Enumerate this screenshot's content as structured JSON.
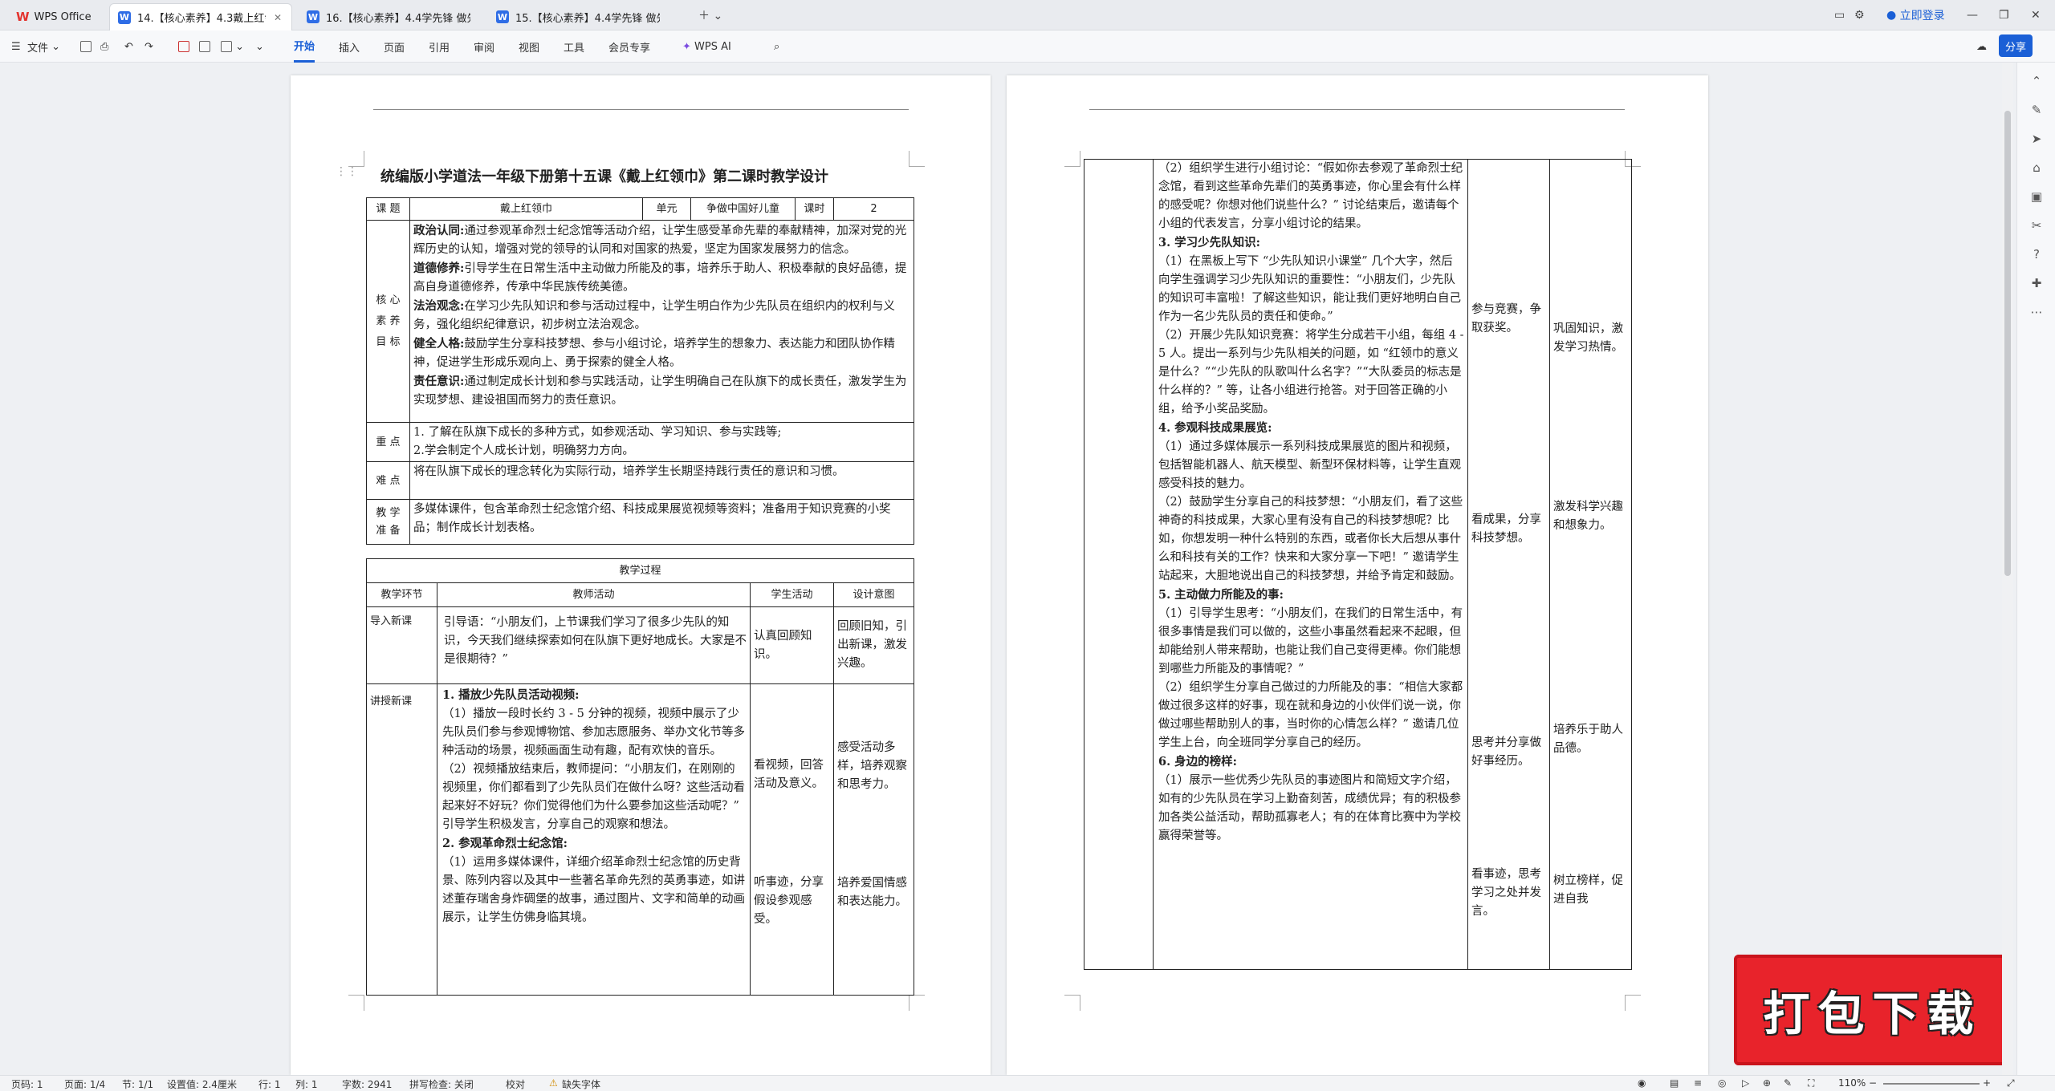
{
  "tabs": [
    {
      "label": "WPS Office"
    },
    {
      "label": "14.【核心素养】4.3戴上红领巾"
    },
    {
      "label": "16.【核心素养】4.4学先锋 做先锋 第"
    },
    {
      "label": "15.【核心素养】4.4学先锋 做先锋 第"
    }
  ],
  "window": {
    "login_label": "立即登录",
    "share_label": "分享"
  },
  "toolbar": {
    "file_label": "文件",
    "menus": [
      "开始",
      "插入",
      "页面",
      "引用",
      "审阅",
      "视图",
      "工具",
      "会员专享"
    ],
    "ai_label": "WPS AI"
  },
  "doc": {
    "title": "统编版小学道法一年级下册第十五课《戴上红领巾》第二课时教学设计",
    "info": {
      "course_label": "课 题",
      "course": "戴上红领巾",
      "unit_label": "单元",
      "unit": "争做中国好儿童",
      "period_label": "课时",
      "period": "2"
    },
    "goals_label": "核 心 素 养 目 标",
    "goals": [
      {
        "h": "政治认同:",
        "t": "通过参观革命烈士纪念馆等活动介绍，让学生感受革命先辈的奉献精神，加深对党的光辉历史的认知，增强对党的领导的认同和对国家的热爱，坚定为国家发展努力的信念。"
      },
      {
        "h": "道德修养:",
        "t": "引导学生在日常生活中主动做力所能及的事，培养乐于助人、积极奉献的良好品德，提高自身道德修养，传承中华民族传统美德。"
      },
      {
        "h": "法治观念:",
        "t": "在学习少先队知识和参与活动过程中，让学生明白作为少先队员在组织内的权利与义务，强化组织纪律意识，初步树立法治观念。"
      },
      {
        "h": "健全人格:",
        "t": "鼓励学生分享科技梦想、参与小组讨论，培养学生的想象力、表达能力和团队协作精神，促进学生形成乐观向上、勇于探索的健全人格。"
      },
      {
        "h": "责任意识:",
        "t": "通过制定成长计划和参与实践活动，让学生明确自己在队旗下的成长责任，激发学生为实现梦想、建设祖国而努力的责任意识。"
      }
    ],
    "key_label": "重 点",
    "key": [
      "1. 了解在队旗下成长的多种方式，如参观活动、学习知识、参与实践等;",
      "2.学会制定个人成长计划，明确努力方向。"
    ],
    "diff_label": "难 点",
    "diff": "将在队旗下成长的理念转化为实际行动，培养学生长期坚持践行责任的意识和习惯。",
    "prep_label": "教 学 准 备",
    "prep": "多媒体课件，包含革命烈士纪念馆介绍、科技成果展览视频等资料；准备用于知识竞赛的小奖品；制作成长计划表格。",
    "process_label": "教学过程",
    "headers": [
      "教学环节",
      "教师活动",
      "学生活动",
      "设计意图"
    ],
    "intro": {
      "stage": "导入新课",
      "teacher": "引导语：“小朋友们，上节课我们学习了很多少先队的知识，今天我们继续探索如何在队旗下更好地成长。大家是不是很期待？”",
      "student": "认真回顾知识。",
      "intent": "回顾旧知，引出新课，激发兴趣。"
    },
    "lesson": {
      "stage": "讲授新课",
      "t1h": "1.  播放少先队员活动视频:",
      "t1a": "（1）播放一段时长约 3 - 5 分钟的视频，视频中展示了少先队员们参与参观博物馆、参加志愿服务、举办文化节等多种活动的场景，视频画面生动有趣，配有欢快的音乐。",
      "t1b": "（2）视频播放结束后，教师提问：“小朋友们，在刚刚的视频里，你们都看到了少先队员们在做什么呀？这些活动看起来好不好玩？你们觉得他们为什么要参加这些活动呢？”  引导学生积极发言，分享自己的观察和想法。",
      "t2h": "2.  参观革命烈士纪念馆:",
      "t2a": "（1）运用多媒体课件，详细介绍革命烈士纪念馆的历史背景、陈列内容以及其中一些著名革命先烈的英勇事迹，如讲述董存瑞舍身炸碉堡的故事，通过图片、文字和简单的动画展示，让学生仿佛身临其境。",
      "s1": "看视频，回答活动及意义。",
      "i1": "感受活动多样，培养观察和思考力。",
      "s2": "听事迹，分享假设参观感受。",
      "i2": "培养爱国情感和表达能力。"
    },
    "p2": {
      "a": "（2）组织学生进行小组讨论：“假如你去参观了革命烈士纪念馆，看到这些革命先辈们的英勇事迹，你心里会有什么样的感受呢？你想对他们说些什么？”  讨论结束后，邀请每个小组的代表发言，分享小组讨论的结果。",
      "h3": "3.  学习少先队知识:",
      "b": "（1）在黑板上写下 “少先队知识小课堂” 几个大字，然后向学生强调学习少先队知识的重要性：“小朋友们，少先队的知识可丰富啦！了解这些知识，能让我们更好地明白自己作为一名少先队员的责任和使命。”",
      "c": "（2）开展少先队知识竞赛：将学生分成若干小组，每组 4 - 5 人。提出一系列与少先队相关的问题，如 “红领巾的意义是什么？”“少先队的队歌叫什么名字？”“大队委员的标志是什么样的？” 等，让各小组进行抢答。对于回答正确的小组，给予小奖品奖励。",
      "h4": "4.  参观科技成果展览:",
      "d": "（1）通过多媒体展示一系列科技成果展览的图片和视频，包括智能机器人、航天模型、新型环保材料等，让学生直观感受科技的魅力。",
      "e": "（2）鼓励学生分享自己的科技梦想：“小朋友们，看了这些神奇的科技成果，大家心里有没有自己的科技梦想呢？比如，你想发明一种什么特别的东西，或者你长大后想从事什么和科技有关的工作？快来和大家分享一下吧！”  邀请学生站起来，大胆地说出自己的科技梦想，并给予肯定和鼓励。",
      "h5": "5.  主动做力所能及的事:",
      "f": "（1）引导学生思考：“小朋友们，在我们的日常生活中，有很多事情是我们可以做的，这些小事虽然看起来不起眼，但却能给别人带来帮助，也能让我们自己变得更棒。你们能想到哪些力所能及的事情呢？”",
      "g": "（2）组织学生分享自己做过的力所能及的事：“相信大家都做过很多这样的好事，现在就和身边的小伙伴们说一说，你做过哪些帮助别人的事，当时你的心情怎么样？”  邀请几位学生上台，向全班同学分享自己的经历。",
      "h6": "6.  身边的榜样:",
      "h": "（1）展示一些优秀少先队员的事迹图片和简短文字介绍，如有的少先队员在学习上勤奋刻苦，成绩优异；有的积极参加各类公益活动，帮助孤寡老人；有的在体育比赛中为学校赢得荣誉等。",
      "s_a": "参与竞赛，争取获奖。",
      "i_a": "巩固知识，激发学习热情。",
      "s_b": "看成果，分享科技梦想。",
      "i_b": "激发科学兴趣和想象力。",
      "s_c": "思考并分享做好事经历。",
      "i_c": "培养乐于助人品德。",
      "s_d": "看事迹，思考学习之处并发言。",
      "i_d": "树立榜样，促进自我"
    }
  },
  "status": {
    "page": "页码: 1",
    "pages": "页面: 1/4",
    "section": "节: 1/1",
    "setting": "设置值: 2.4厘米",
    "row": "行: 1",
    "col": "列: 1",
    "words": "字数: 2941",
    "spell": "拼写检查: 关闭",
    "proof": "校对",
    "missing_font": "缺失字体",
    "zoom": "110%"
  },
  "badge": {
    "text": "打包下载"
  }
}
